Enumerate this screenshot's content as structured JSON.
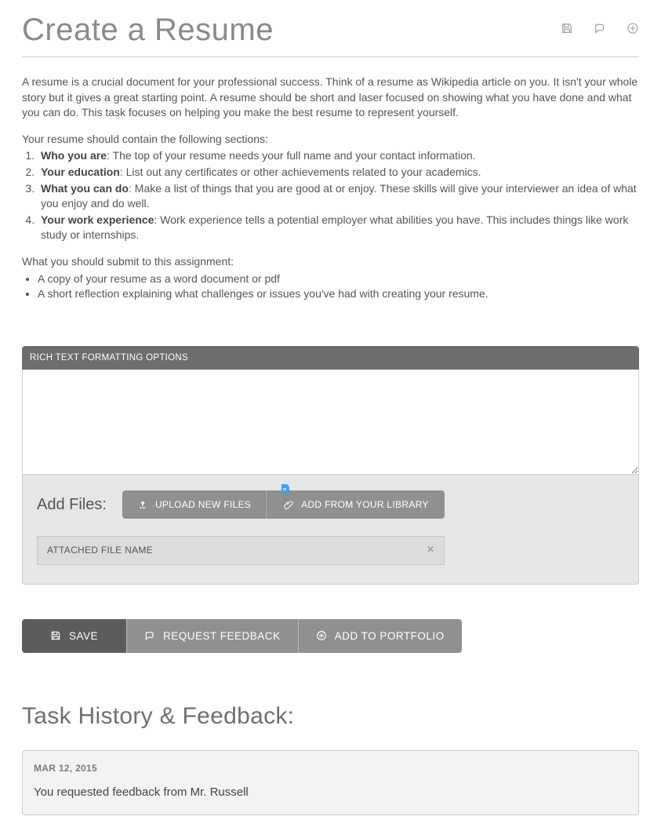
{
  "header": {
    "title": "Create a Resume"
  },
  "intro": {
    "lead": "A resume is a crucial document for your professional success. Think of a resume as Wikipedia article on you. It isn't your whole story but it gives a great starting point. A resume should be short and laser focused on showing what you have done and what you can do. This task focuses on helping you make the best resume to represent yourself.",
    "sections_label": "Your resume should contain the following sections:",
    "sections": [
      {
        "bold": "Who you are",
        "rest": ":  The top of your resume needs your full name and your contact information."
      },
      {
        "bold": "Your education",
        "rest": ": List out any certificates or other achievements related to your academics."
      },
      {
        "bold": "What you can do",
        "rest": ": Make a list of things that you are good at or enjoy. These skills will give your interviewer an idea of what you enjoy and do well."
      },
      {
        "bold": "Your work experience",
        "rest": ": Work experience tells a potential employer what abilities you have. This includes things like work study or internships."
      }
    ],
    "submit_label": "What you should submit to this assignment:",
    "submit_items": [
      "A copy of your resume as a word document or pdf",
      "A short reflection explaining what challenges or issues you've had with creating your resume."
    ]
  },
  "editor": {
    "toolbar_label": "RICH TEXT FORMATTING OPTIONS",
    "value": ""
  },
  "addfiles": {
    "label": "Add Files:",
    "upload_label": "UPLOAD NEW FILES",
    "library_label": "ADD FROM YOUR LIBRARY",
    "attached_name": "ATTACHED FILE NAME"
  },
  "actions": {
    "save": "SAVE",
    "request": "REQUEST FEEDBACK",
    "portfolio": "ADD TO PORTFOLIO"
  },
  "history": {
    "title": "Task History & Feedback:",
    "date": "MAR 12, 2015",
    "message": "You requested feedback from Mr. Russell"
  }
}
